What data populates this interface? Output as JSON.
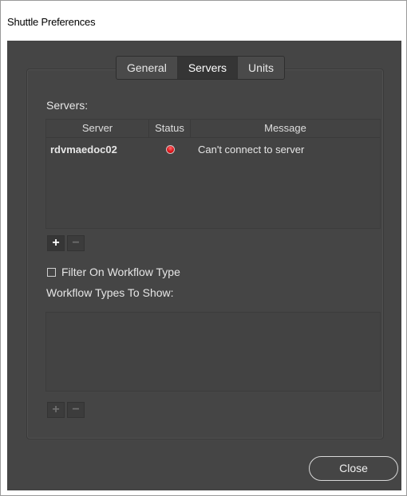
{
  "window": {
    "title": "Shuttle Preferences"
  },
  "tabs": [
    {
      "label": "General",
      "active": false
    },
    {
      "label": "Servers",
      "active": true
    },
    {
      "label": "Units",
      "active": false
    }
  ],
  "servers": {
    "label": "Servers:",
    "columns": [
      "Server",
      "Status",
      "Message"
    ],
    "rows": [
      {
        "server": "rdvmaedoc02",
        "status": "error",
        "status_color": "#e0161c",
        "message": "Can't connect to server"
      }
    ],
    "add_label": "+",
    "remove_label": "−"
  },
  "filter": {
    "checkbox_label": "Filter On Workflow Type",
    "checked": false,
    "workflow_label": "Workflow Types To Show:",
    "add_label": "+",
    "remove_label": "−"
  },
  "footer": {
    "close_label": "Close"
  },
  "colors": {
    "background": "#454545",
    "status_error": "#e0161c"
  }
}
